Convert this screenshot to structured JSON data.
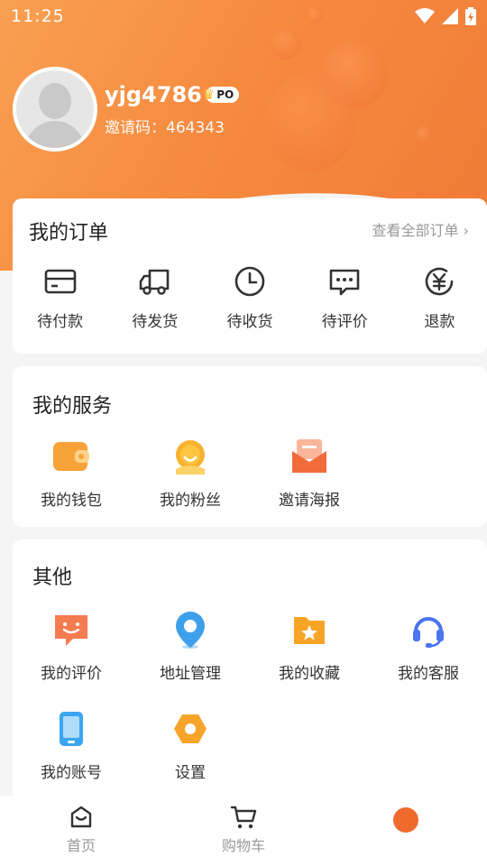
{
  "status_bar": {
    "time": "11:25"
  },
  "profile": {
    "username": "yjg4786",
    "badge": "PO",
    "invite_label": "邀请码：464343"
  },
  "orders": {
    "title": "我的订单",
    "view_all": "查看全部订单 ›",
    "items": [
      {
        "label": "待付款",
        "icon": "card-icon"
      },
      {
        "label": "待发货",
        "icon": "truck-icon"
      },
      {
        "label": "待收货",
        "icon": "clock-icon"
      },
      {
        "label": "待评价",
        "icon": "comment-icon"
      },
      {
        "label": "退款",
        "icon": "yen-icon"
      }
    ]
  },
  "services": {
    "title": "我的服务",
    "items": [
      {
        "label": "我的钱包",
        "icon": "wallet-icon"
      },
      {
        "label": "我的粉丝",
        "icon": "fans-icon"
      },
      {
        "label": "邀请海报",
        "icon": "poster-icon"
      }
    ]
  },
  "others": {
    "title": "其他",
    "items": [
      {
        "label": "我的评价",
        "icon": "smile-chat-icon"
      },
      {
        "label": "地址管理",
        "icon": "location-icon"
      },
      {
        "label": "我的收藏",
        "icon": "star-folder-icon"
      },
      {
        "label": "我的客服",
        "icon": "headset-icon"
      },
      {
        "label": "我的账号",
        "icon": "phone-icon"
      },
      {
        "label": "设置",
        "icon": "settings-icon"
      }
    ]
  },
  "bottom_nav": {
    "items": [
      {
        "label": "首页"
      },
      {
        "label": "购物车"
      }
    ]
  },
  "colors": {
    "accent": "#f07a36",
    "accent_light": "#f9a052"
  }
}
